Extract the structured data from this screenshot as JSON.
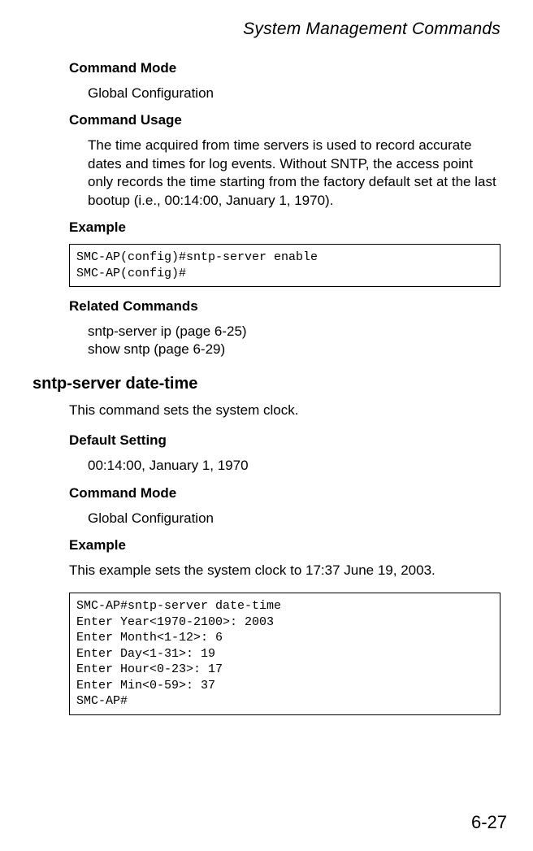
{
  "header": {
    "title": "System Management Commands"
  },
  "section1": {
    "command_mode_heading": "Command Mode",
    "command_mode_text": "Global Configuration",
    "command_usage_heading": "Command Usage",
    "command_usage_text": "The time acquired from time servers is used to record accurate dates and times for log events. Without SNTP, the access point only records the time starting from the factory default set at the last bootup (i.e., 00:14:00, January 1, 1970).",
    "example_heading": "Example",
    "example_code": "SMC-AP(config)#sntp-server enable\nSMC-AP(config)#",
    "related_heading": "Related Commands",
    "related_line1": "sntp-server ip (page 6-25)",
    "related_line2": "show sntp (page 6-29)"
  },
  "section2": {
    "title": "sntp-server date-time",
    "intro": "This command sets the system clock.",
    "default_setting_heading": "Default Setting",
    "default_setting_text": "00:14:00, January 1, 1970",
    "command_mode_heading": "Command Mode",
    "command_mode_text": "Global Configuration",
    "example_heading": "Example",
    "example_intro": "This example sets the system clock to 17:37 June 19, 2003.",
    "example_code": "SMC-AP#sntp-server date-time\nEnter Year<1970-2100>: 2003\nEnter Month<1-12>: 6\nEnter Day<1-31>: 19\nEnter Hour<0-23>: 17\nEnter Min<0-59>: 37\nSMC-AP#"
  },
  "footer": {
    "page_number": "6-27"
  }
}
